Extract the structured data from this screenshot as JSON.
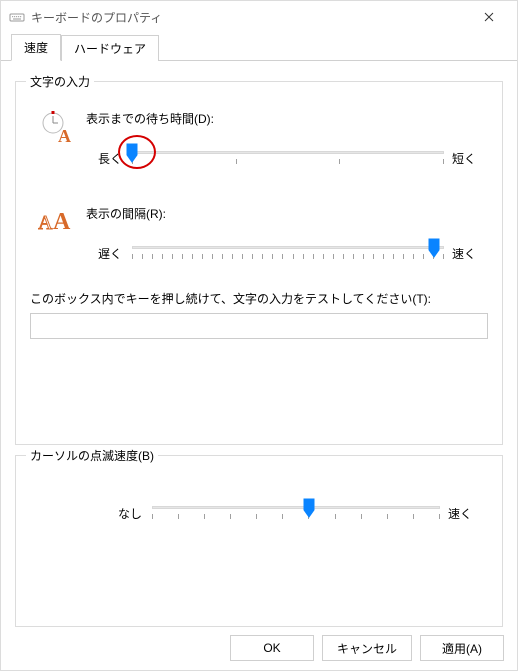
{
  "window": {
    "title": "キーボードのプロパティ"
  },
  "tabs": [
    {
      "label": "速度",
      "active": true
    },
    {
      "label": "ハードウェア",
      "active": false
    }
  ],
  "group_input": {
    "title": "文字の入力",
    "delay": {
      "label": "表示までの待ち時間(D):",
      "left": "長く",
      "right": "短く",
      "ticks": 4,
      "value_index": 0
    },
    "rate": {
      "label": "表示の間隔(R):",
      "left": "遅く",
      "right": "速く",
      "ticks": 32,
      "value_index": 30
    },
    "test": {
      "label": "このボックス内でキーを押し続けて、文字の入力をテストしてください(T):",
      "value": ""
    }
  },
  "group_blink": {
    "title": "カーソルの点滅速度(B)",
    "left": "なし",
    "right": "速く",
    "ticks": 12,
    "value_index": 6
  },
  "buttons": {
    "ok": "OK",
    "cancel": "キャンセル",
    "apply": "適用(A)"
  },
  "annotation": {
    "highlight": "repeat-delay-slider-thumb"
  },
  "chart_data": {
    "type": "table",
    "title": "キーボードのプロパティ — スライダー状態",
    "sliders": [
      {
        "name": "表示までの待ち時間",
        "min_label": "長く",
        "max_label": "短く",
        "steps": 4,
        "current_step_index": 0
      },
      {
        "name": "表示の間隔",
        "min_label": "遅く",
        "max_label": "速く",
        "steps": 32,
        "current_step_index": 30
      },
      {
        "name": "カーソルの点滅速度",
        "min_label": "なし",
        "max_label": "速く",
        "steps": 12,
        "current_step_index": 6
      }
    ]
  }
}
